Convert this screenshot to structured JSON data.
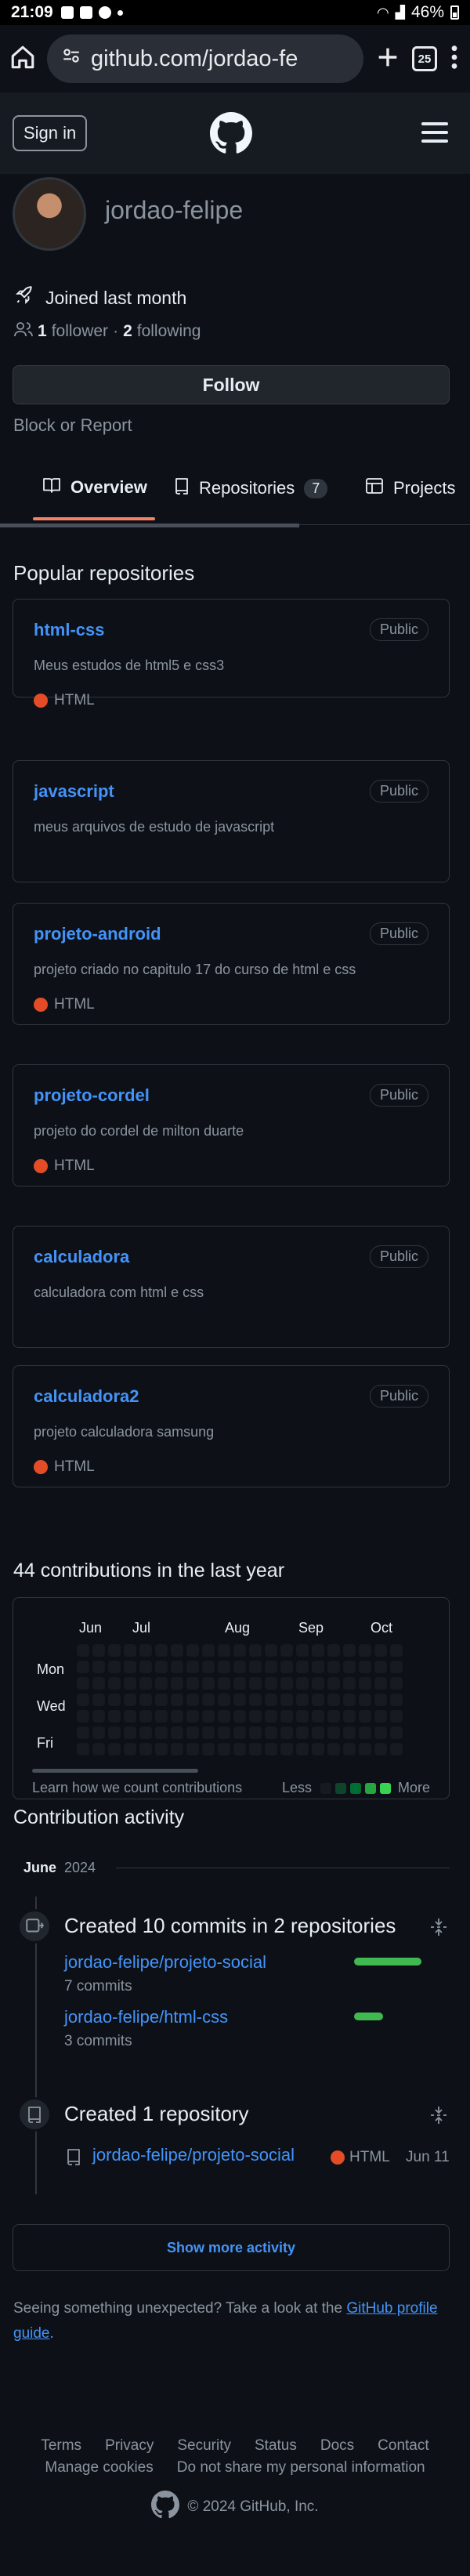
{
  "statusbar": {
    "time": "21:09",
    "battery": "46%"
  },
  "browser": {
    "url": "github.com/jordao-fe",
    "tab_count": "25"
  },
  "header": {
    "signin_label": "Sign in"
  },
  "profile": {
    "username": "jordao-felipe",
    "joined": "Joined last month",
    "followers_count": "1",
    "followers_label": "follower",
    "separator": "·",
    "following_count": "2",
    "following_label": "following",
    "follow_button": "Follow",
    "block_report": "Block or Report"
  },
  "tabs": [
    {
      "label": "Overview"
    },
    {
      "label": "Repositories",
      "count": "7"
    },
    {
      "label": "Projects"
    }
  ],
  "popular": {
    "title": "Popular repositories",
    "repos": [
      {
        "name": "html-css",
        "visibility": "Public",
        "description": "Meus estudos de html5 e css3",
        "language": "HTML"
      },
      {
        "name": "javascript",
        "visibility": "Public",
        "description": "meus arquivos de estudo de javascript",
        "language": ""
      },
      {
        "name": "projeto-android",
        "visibility": "Public",
        "description": "projeto criado no capitulo 17 do curso de html e css",
        "language": "HTML"
      },
      {
        "name": "projeto-cordel",
        "visibility": "Public",
        "description": "projeto do cordel de milton duarte",
        "language": "HTML"
      },
      {
        "name": "calculadora",
        "visibility": "Public",
        "description": "calculadora com html e css",
        "language": ""
      },
      {
        "name": "calculadora2",
        "visibility": "Public",
        "description": "projeto calculadora samsung",
        "language": "HTML"
      }
    ]
  },
  "contributions": {
    "title": "44 contributions in the last year",
    "months": [
      "Jun",
      "Jul",
      "Aug",
      "Sep",
      "Oct"
    ],
    "days": [
      "Mon",
      "Wed",
      "Fri"
    ],
    "learn": "Learn how we count contributions",
    "less": "Less",
    "more": "More",
    "legend_colors": [
      "#161b22",
      "#0e4429",
      "#006d32",
      "#26a641",
      "#39d353"
    ]
  },
  "activity": {
    "title": "Contribution activity",
    "month": "June",
    "year": "2024",
    "commits_heading": "Created 10 commits in 2 repositories",
    "commit_repos": [
      {
        "name": "jordao-felipe/projeto-social",
        "count": "7 commits",
        "share": 0.7
      },
      {
        "name": "jordao-felipe/html-css",
        "count": "3 commits",
        "share": 0.3
      }
    ],
    "repo_heading": "Created 1 repository",
    "created_repo": {
      "name": "jordao-felipe/projeto-social",
      "language": "HTML",
      "date": "Jun 11"
    },
    "show_more": "Show more activity"
  },
  "notice": {
    "text": "Seeing something unexpected? Take a look at the ",
    "link": "GitHub profile guide",
    "end": "."
  },
  "footer": {
    "links": [
      "Terms",
      "Privacy",
      "Security",
      "Status",
      "Docs",
      "Contact"
    ],
    "links2": [
      "Manage cookies",
      "Do not share my personal information"
    ],
    "copyright": "© 2024 GitHub, Inc."
  }
}
